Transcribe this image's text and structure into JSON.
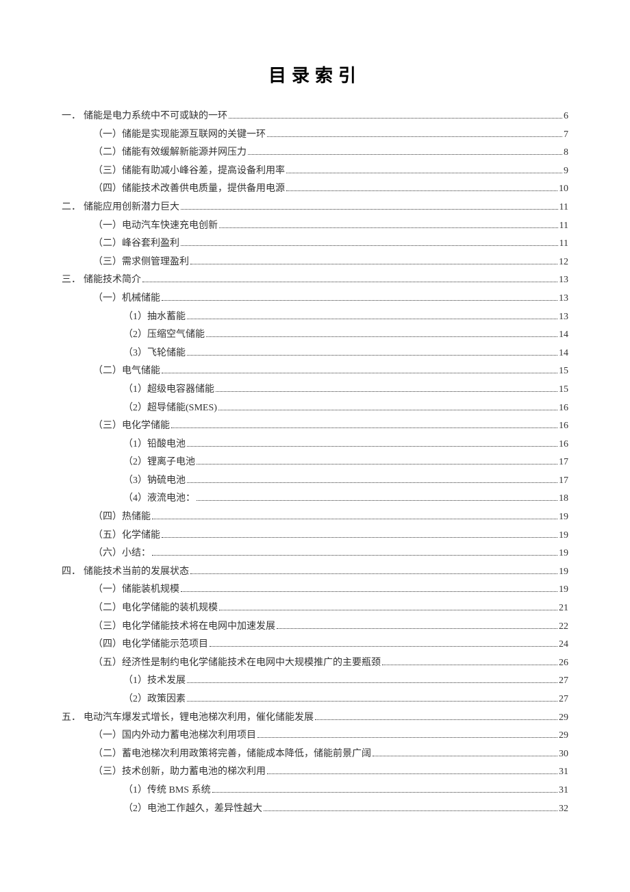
{
  "title": "目录索引",
  "toc": [
    {
      "level": 1,
      "marker": "一．",
      "text": "储能是电力系统中不可或缺的一环",
      "page": "6"
    },
    {
      "level": 2,
      "text": "（一）储能是实现能源互联网的关键一环",
      "page": "7"
    },
    {
      "level": 2,
      "text": "（二）储能有效缓解新能源并网压力",
      "page": "8"
    },
    {
      "level": 2,
      "text": "（三）储能有助减小峰谷差，提高设备利用率",
      "page": "9"
    },
    {
      "level": 2,
      "text": "（四）储能技术改善供电质量，提供备用电源",
      "page": "10"
    },
    {
      "level": 1,
      "marker": "二．",
      "text": "储能应用创新潜力巨大",
      "page": "11"
    },
    {
      "level": 2,
      "text": "（一）电动汽车快速充电创新",
      "page": "11"
    },
    {
      "level": 2,
      "text": "（二）峰谷套利盈利",
      "page": "11"
    },
    {
      "level": 2,
      "text": "（三）需求侧管理盈利",
      "page": "12"
    },
    {
      "level": 1,
      "marker": "三．",
      "text": "储能技术简介",
      "page": "13"
    },
    {
      "level": 2,
      "text": "（一）机械储能",
      "page": "13"
    },
    {
      "level": 3,
      "text": "（1）抽水蓄能",
      "page": "13"
    },
    {
      "level": 3,
      "text": "（2）压缩空气储能",
      "page": "14"
    },
    {
      "level": 3,
      "text": "（3）飞轮储能",
      "page": "14"
    },
    {
      "level": 2,
      "text": "（二）电气储能",
      "page": "15"
    },
    {
      "level": 3,
      "text": "（1）超级电容器储能",
      "page": "15"
    },
    {
      "level": 3,
      "text": "（2）超导储能(SMES)",
      "page": "16"
    },
    {
      "level": 2,
      "text": "（三）电化学储能",
      "page": "16"
    },
    {
      "level": 3,
      "text": "（1）铅酸电池",
      "page": "16"
    },
    {
      "level": 3,
      "text": "（2）锂离子电池",
      "page": "17"
    },
    {
      "level": 3,
      "text": "（3）钠硫电池",
      "page": "17"
    },
    {
      "level": 3,
      "text": "（4）液流电池：",
      "page": "18"
    },
    {
      "level": 2,
      "text": "（四）热储能",
      "page": "19"
    },
    {
      "level": 2,
      "text": "（五）化学储能",
      "page": "19"
    },
    {
      "level": 2,
      "text": "（六）小结：",
      "page": "19"
    },
    {
      "level": 1,
      "marker": "四．",
      "text": "储能技术当前的发展状态",
      "page": "19"
    },
    {
      "level": 2,
      "text": "（一）储能装机规模",
      "page": "19"
    },
    {
      "level": 2,
      "text": "（二）电化学储能的装机规模",
      "page": "21"
    },
    {
      "level": 2,
      "text": "（三）电化学储能技术将在电网中加速发展",
      "page": "22"
    },
    {
      "level": 2,
      "text": "（四）电化学储能示范项目",
      "page": "24"
    },
    {
      "level": 2,
      "text": "（五）经济性是制约电化学储能技术在电网中大规模推广的主要瓶颈",
      "page": "26"
    },
    {
      "level": 3,
      "text": "（1）技术发展",
      "page": "27"
    },
    {
      "level": 3,
      "text": "（2）政策因素",
      "page": "27"
    },
    {
      "level": 1,
      "marker": "五．",
      "text": "电动汽车爆发式增长，锂电池梯次利用，催化储能发展",
      "page": "29"
    },
    {
      "level": 2,
      "text": "（一）国内外动力蓄电池梯次利用项目",
      "page": "29"
    },
    {
      "level": 2,
      "text": "（二）蓄电池梯次利用政策将完善，储能成本降低，储能前景广阔",
      "page": "30"
    },
    {
      "level": 2,
      "text": "（三）技术创新，助力蓄电池的梯次利用",
      "page": "31"
    },
    {
      "level": 3,
      "text": "（1）传统 BMS 系统",
      "page": "31"
    },
    {
      "level": 3,
      "text": "（2）电池工作越久，差异性越大",
      "page": "32"
    }
  ]
}
